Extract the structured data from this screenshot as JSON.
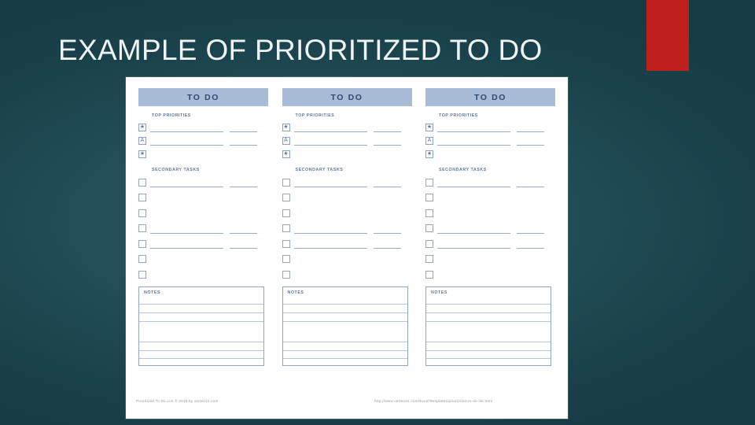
{
  "slide": {
    "title": "EXAMPLE OF PRIORITIZED TO DO",
    "background_color": "#235059",
    "accent_color": "#c0201c",
    "sheet_color": "#ffffff"
  },
  "sheet": {
    "header_bg_color": "#a8bcd8",
    "header_text_color": "#2e4a6e",
    "columns": [
      {
        "title": "TO DO",
        "top_priorities_label": "TOP PRIORITIES",
        "priority_rows": [
          {
            "icon": "star-icon",
            "glyph": "★",
            "long_line": true,
            "short_line": true
          },
          {
            "icon": "letter-a-icon",
            "glyph": "A",
            "long_line": true,
            "short_line": true
          },
          {
            "icon": "star-icon",
            "glyph": "★",
            "long_line": false,
            "short_line": false
          }
        ],
        "secondary_tasks_label": "SECONDARY TASKS",
        "secondary_rows": [
          {
            "icon": "checkbox-icon",
            "long_line": true,
            "short_line": true
          },
          {
            "icon": "checkbox-icon",
            "long_line": false,
            "short_line": false
          },
          {
            "icon": "checkbox-icon",
            "long_line": false,
            "short_line": false
          },
          {
            "icon": "checkbox-icon",
            "long_line": true,
            "short_line": true
          },
          {
            "icon": "checkbox-icon",
            "long_line": true,
            "short_line": true
          },
          {
            "icon": "checkbox-icon",
            "long_line": false,
            "short_line": false
          },
          {
            "icon": "checkbox-icon",
            "long_line": false,
            "short_line": false
          }
        ],
        "notes_label": "NOTES",
        "notes_line_heights": [
          20,
          11,
          11,
          29,
          11,
          11,
          8
        ]
      },
      {
        "title": "TO DO",
        "top_priorities_label": "TOP PRIORITIES",
        "priority_rows": [
          {
            "icon": "star-icon",
            "glyph": "★",
            "long_line": true,
            "short_line": true
          },
          {
            "icon": "letter-a-icon",
            "glyph": "A",
            "long_line": true,
            "short_line": true
          },
          {
            "icon": "star-icon",
            "glyph": "★",
            "long_line": false,
            "short_line": false
          }
        ],
        "secondary_tasks_label": "SECONDARY TASKS",
        "secondary_rows": [
          {
            "icon": "checkbox-icon",
            "long_line": true,
            "short_line": true
          },
          {
            "icon": "checkbox-icon",
            "long_line": false,
            "short_line": false
          },
          {
            "icon": "checkbox-icon",
            "long_line": false,
            "short_line": false
          },
          {
            "icon": "checkbox-icon",
            "long_line": true,
            "short_line": true
          },
          {
            "icon": "checkbox-icon",
            "long_line": true,
            "short_line": true
          },
          {
            "icon": "checkbox-icon",
            "long_line": false,
            "short_line": false
          },
          {
            "icon": "checkbox-icon",
            "long_line": false,
            "short_line": false
          }
        ],
        "notes_label": "NOTES",
        "notes_line_heights": [
          20,
          11,
          11,
          29,
          11,
          11,
          8
        ]
      },
      {
        "title": "TO DO",
        "top_priorities_label": "TOP PRIORITIES",
        "priority_rows": [
          {
            "icon": "star-icon",
            "glyph": "★",
            "long_line": true,
            "short_line": true
          },
          {
            "icon": "letter-a-icon",
            "glyph": "A",
            "long_line": true,
            "short_line": true
          },
          {
            "icon": "star-icon",
            "glyph": "★",
            "long_line": false,
            "short_line": false
          }
        ],
        "secondary_tasks_label": "SECONDARY TASKS",
        "secondary_rows": [
          {
            "icon": "checkbox-icon",
            "long_line": true,
            "short_line": true
          },
          {
            "icon": "checkbox-icon",
            "long_line": false,
            "short_line": false
          },
          {
            "icon": "checkbox-icon",
            "long_line": false,
            "short_line": false
          },
          {
            "icon": "checkbox-icon",
            "long_line": true,
            "short_line": true
          },
          {
            "icon": "checkbox-icon",
            "long_line": true,
            "short_line": true
          },
          {
            "icon": "checkbox-icon",
            "long_line": false,
            "short_line": false
          },
          {
            "icon": "checkbox-icon",
            "long_line": false,
            "short_line": false
          }
        ],
        "notes_label": "NOTES",
        "notes_line_heights": [
          20,
          11,
          11,
          29,
          11,
          11,
          8
        ]
      }
    ],
    "footer": {
      "left": "Prioritized To Do List © 2015 by vertex42.com",
      "right": "http://www.vertex42.com/ExcelTemplates/prioritized-to-do-list.html"
    }
  }
}
